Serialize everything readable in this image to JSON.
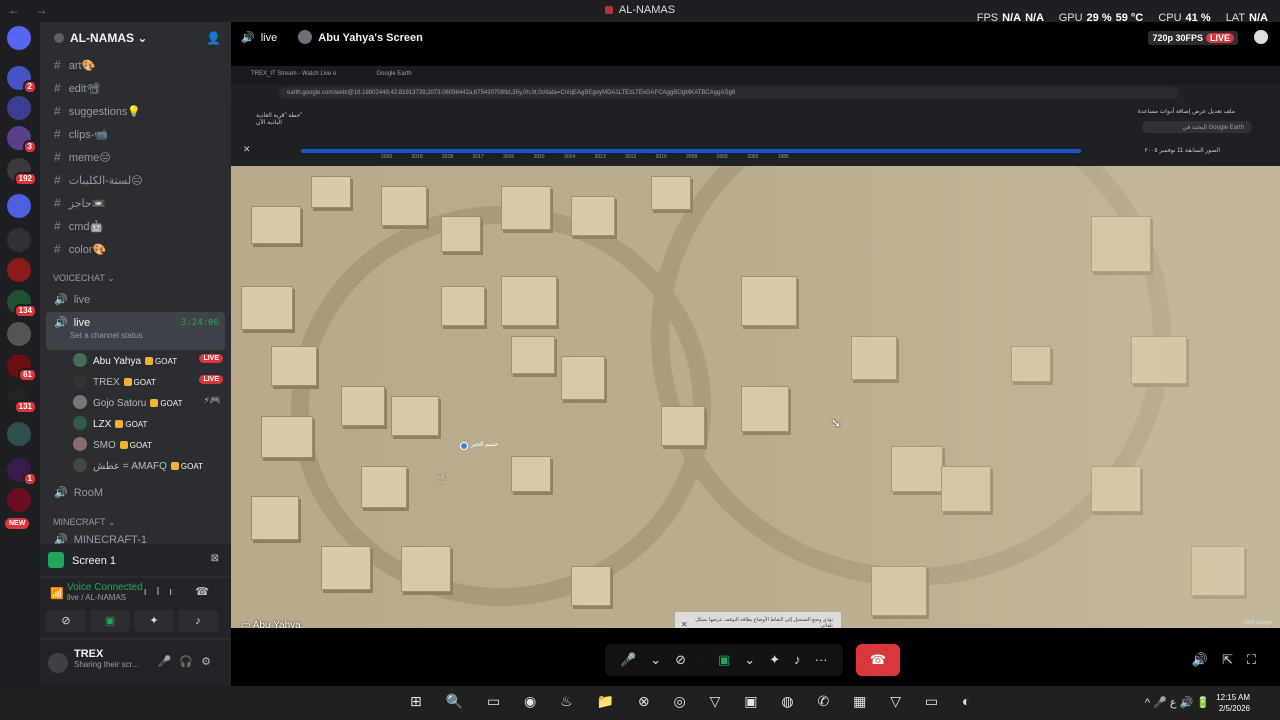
{
  "window": {
    "title": "AL-NAMAS",
    "perf": {
      "fps_label": "FPS",
      "fps1": "N/A",
      "fps2": "N/A",
      "gpu_label": "GPU",
      "gpu": "29 %",
      "gpu_temp": "59 °C",
      "cpu_label": "CPU",
      "cpu": "41 %",
      "lat_label": "LAT",
      "lat": "N/A"
    }
  },
  "rail": {
    "badges": [
      "2",
      "3",
      "192",
      "134",
      "61",
      "131",
      "1"
    ],
    "new_label": "NEW"
  },
  "server": {
    "name": "AL-NAMAS",
    "channels": [
      {
        "name": "art",
        "emoji": "🎨"
      },
      {
        "name": "edit",
        "emoji": "📽"
      },
      {
        "name": "suggestions",
        "emoji": "💡"
      },
      {
        "name": "clips-",
        "emoji": "📹"
      },
      {
        "name": "meme",
        "emoji": "😑"
      },
      {
        "name": "لستة-الكليبات",
        "emoji": "😑"
      },
      {
        "name": "حاجز",
        "emoji": "📼"
      },
      {
        "name": "cmd",
        "emoji": "🤖"
      },
      {
        "name": "color",
        "emoji": "🎨"
      }
    ],
    "voice_category": "VOICECHAT",
    "voice_channels": [
      {
        "name": "live"
      },
      {
        "name": "live",
        "time": "3:24:06",
        "status": "Set a channel status"
      }
    ],
    "members": [
      {
        "name": "Abu Yahya",
        "tag": "GOAT",
        "live": "LIVE"
      },
      {
        "name": "TREX",
        "tag": "GOAT",
        "live": "LIVE"
      },
      {
        "name": "Gojo Satoru",
        "tag": "GOAT",
        "extra": "⚡🎮"
      },
      {
        "name": "LZX",
        "tag": "GOAT"
      },
      {
        "name": "SMO",
        "tag": "GOAT"
      },
      {
        "name": "عطش = AMAFQ",
        "tag": "GOAT"
      }
    ],
    "room": "RooM",
    "mc_category": "MINECRAFT",
    "mc_channel": "MINECRAFT-1"
  },
  "panel": {
    "screen": "Screen 1",
    "voice_connected": "Voice Connected",
    "voice_sub": "live / AL-NAMAS",
    "user_name": "TREX",
    "user_status": "Sharing their scr..."
  },
  "stream": {
    "channel": "live",
    "streamer": "Abu Yahya's Screen",
    "quality": "720p 30FPS",
    "live": "LIVE",
    "streamer_label": "Abu Yahya",
    "browser_tabs": [
      "TREX_IT Stream - Watch Live o",
      "Google Earth"
    ],
    "url": "earth.google.com/web/@18.18902449,42.81913739,2073.06096442a,6754307089d,35y,0h,0t,0r/data=CnIqEAgBEgoyMDA1LTEzLTExGAFCAggBOgMKATBCAggASg8",
    "place": "حطة \"قرية العادية\"",
    "place_sub": "البادية الآن",
    "menu": "ملف  تعديل  عرض  إضافة  أدوات  مساعدة",
    "search_placeholder": "البحث في Google Earth",
    "years": [
      "2020",
      "2019",
      "2018",
      "2017",
      "2016",
      "2015",
      "2014",
      "2013",
      "2012",
      "2010",
      "2009",
      "2005",
      "2003",
      "1985"
    ],
    "timeline_nav": "الصور السابقة  11 نوفمبر ٢٠٠٥",
    "pin_label": "حسم الخير",
    "notif": "يؤدي وضع التسجيل إلى التقاط الأوضاع بطاقة التوقف عرضها بشكل تلقائي",
    "credit": "1005  Google"
  },
  "taskbar": {
    "time": "12:15 AM",
    "date": "2/5/2026"
  }
}
